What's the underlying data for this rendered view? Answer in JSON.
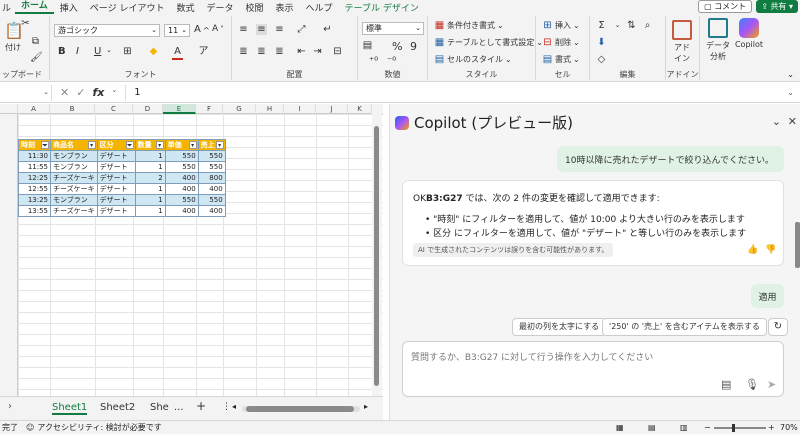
{
  "tabs": [
    "ホーム",
    "挿入",
    "ページ レイアウト",
    "数式",
    "データ",
    "校閲",
    "表示",
    "ヘルプ",
    "テーブル デザイン"
  ],
  "tab_partial_left": "ル",
  "comment_label": "コメント",
  "share_label": "共有",
  "ribbon": {
    "clipboard": {
      "paste": "付け",
      "label": "ップボード"
    },
    "font": {
      "name": "游ゴシック",
      "size": "11",
      "label": "フォント",
      "bold": "B",
      "italic": "I",
      "underline": "U",
      "grow": "A",
      "shrink": "A"
    },
    "align": {
      "label": "配置"
    },
    "number": {
      "format": "標準",
      "label": "数値",
      "pct": "%",
      "comma": "9"
    },
    "styles": {
      "cond": "条件付き書式",
      "table": "テーブルとして書式設定",
      "cell": "セルのスタイル",
      "label": "スタイル"
    },
    "cells": {
      "insert": "挿入",
      "delete": "削除",
      "format": "書式",
      "label": "セル"
    },
    "edit": {
      "label": "編集"
    },
    "addin": {
      "btn": "アド\nイン",
      "btn1": "アド",
      "btn2": "イン",
      "label": "アドイン"
    },
    "data_analysis": {
      "l1": "データ",
      "l2": "分析"
    },
    "copilot": {
      "label": "Copilot"
    }
  },
  "formula": {
    "value": "1",
    "fx": "fx"
  },
  "columns": [
    "A",
    "B",
    "C",
    "D",
    "E",
    "F",
    "G",
    "H",
    "I",
    "J",
    "K",
    "L"
  ],
  "table": {
    "headers": [
      "時刻",
      "商品名",
      "区分",
      "数量",
      "単価",
      "売上"
    ],
    "rows": [
      [
        "11:30",
        "モンブラン",
        "デザート",
        "1",
        "550",
        "550"
      ],
      [
        "11:55",
        "モンブラン",
        "デザート",
        "1",
        "550",
        "550"
      ],
      [
        "12:25",
        "チーズケーキ",
        "デザート",
        "2",
        "400",
        "800"
      ],
      [
        "12:55",
        "チーズケーキ",
        "デザート",
        "1",
        "400",
        "400"
      ],
      [
        "13:25",
        "モンブラン",
        "デザート",
        "1",
        "550",
        "550"
      ],
      [
        "13:55",
        "チーズケーキ",
        "デザート",
        "1",
        "400",
        "400"
      ]
    ]
  },
  "sheets": [
    "Sheet1",
    "Sheet2",
    "She"
  ],
  "sheet_more": "...",
  "sheet_add": "+",
  "status": {
    "ready": "完了",
    "accessibility": "アクセシビリティ: 検討が必要です",
    "zoom": "70%"
  },
  "copilot": {
    "title": "Copilot (プレビュー版)",
    "user_msg": "10時以降に売れたデザートで絞り込んでください。",
    "resp_intro_bold": "B3:G27",
    "resp_intro_pre": "OK",
    "resp_intro_post": " では、次の 2 件の変更を確認して適用できます:",
    "bullet1": "\"時刻\" にフィルターを適用して、値が 10:00 より大きい行のみを表示します",
    "bullet2": "区分 にフィルターを適用して、値が \"デザート\" と等しい行のみを表示します",
    "ai_note": "AI で生成されたコンテンツは誤りを含む可能性があります。",
    "apply_msg": "適用",
    "chip1": "最初の列を太字にする",
    "chip2": "'250' の '売上' を含むアイテムを表示する",
    "placeholder": "質問するか、B3:G27 に対して行う操作を入力してください"
  }
}
